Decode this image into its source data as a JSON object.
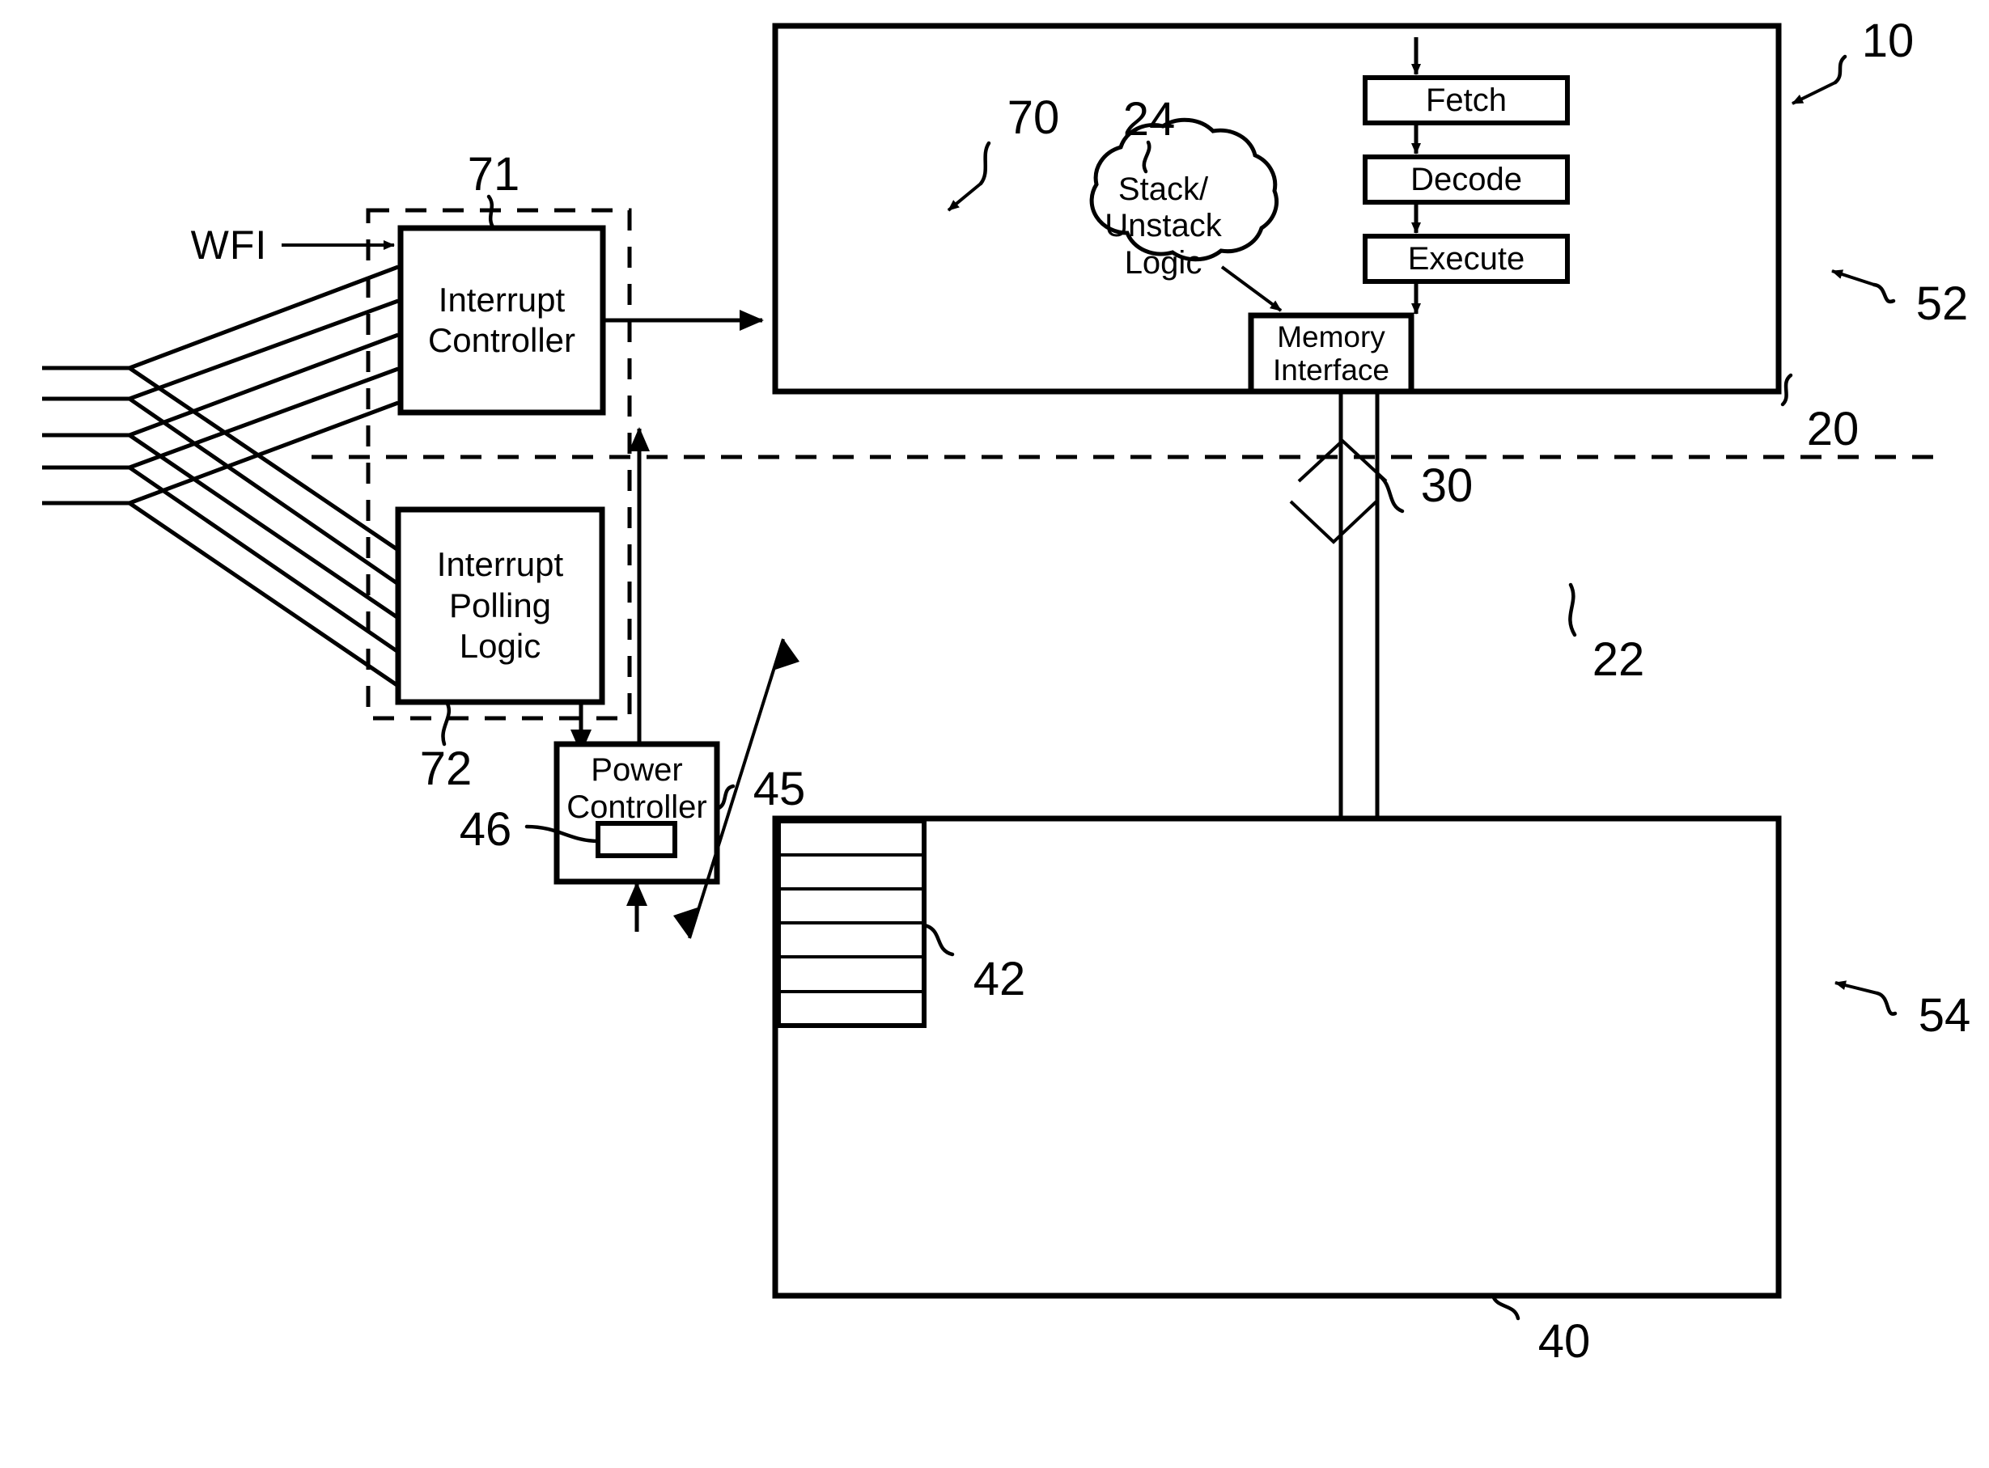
{
  "figure": {
    "type": "patent-block-diagram",
    "background": "#ffffff",
    "stroke_color": "#000000"
  },
  "blocks": {
    "fetch": {
      "label": "Fetch"
    },
    "decode": {
      "label": "Decode"
    },
    "execute": {
      "label": "Execute"
    },
    "memory_interface": {
      "label_line1": "Memory",
      "label_line2": "Interface"
    },
    "stack_logic": {
      "label_line1": "Stack/",
      "label_line2": "Unstack",
      "label_line3": "Logic"
    },
    "interrupt_controller": {
      "label_line1": "Interrupt",
      "label_line2": "Controller"
    },
    "interrupt_polling_logic": {
      "label_line1": "Interrupt",
      "label_line2": "Polling",
      "label_line3": "Logic"
    },
    "power_controller": {
      "label_line1": "Power",
      "label_line2": "Controller"
    },
    "power_register": {
      "label": ""
    }
  },
  "signals": {
    "wfi": {
      "label": "WFI"
    }
  },
  "reference_numerals": {
    "cpu_system": "10",
    "cpu_core": "20",
    "memory_interface": "22",
    "stack_logic": "24",
    "bus": "30",
    "memory": "40",
    "stack_region": "42",
    "power_controller": "45",
    "power_register": "46",
    "domain_upper": "52",
    "domain_lower": "54",
    "interrupt_unit": "70",
    "interrupt_controller": "71",
    "interrupt_polling_logic": "72"
  },
  "interrupt_lines": {
    "count": 5,
    "description": "five interrupt input lines fanning out to both the interrupt controller and the interrupt polling logic"
  },
  "stack_rows": {
    "count": 6
  }
}
